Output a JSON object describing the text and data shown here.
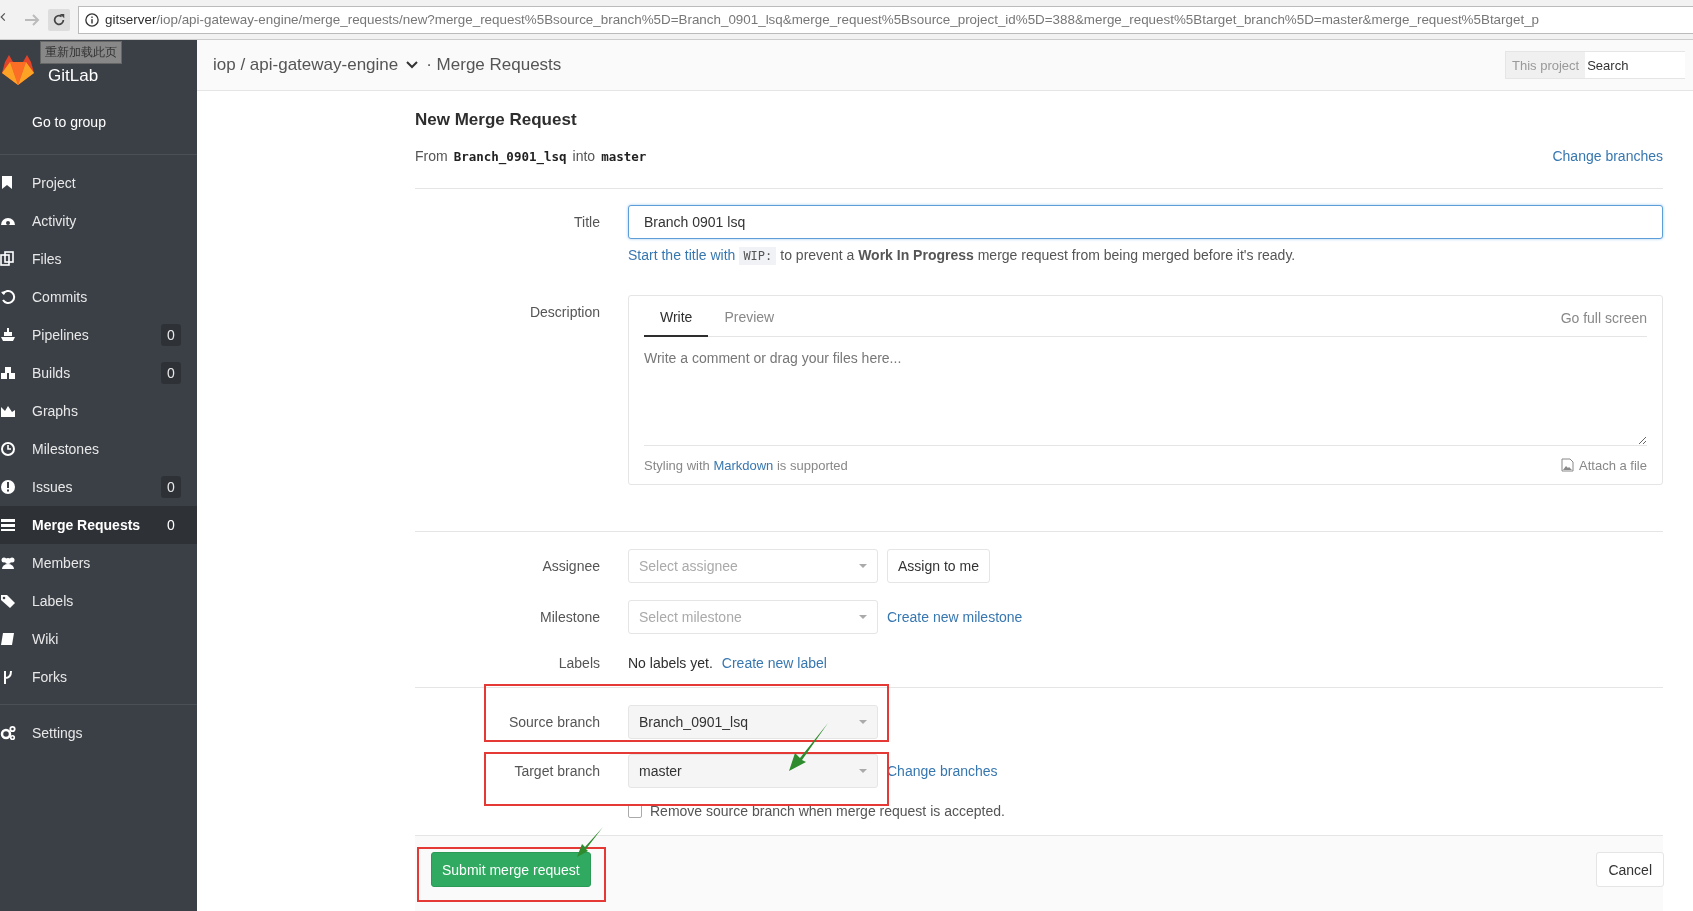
{
  "browser": {
    "url_host": "gitserver",
    "url_path": "/iop/api-gateway-engine/merge_requests/new?merge_request%5Bsource_branch%5D=Branch_0901_lsq&merge_request%5Bsource_project_id%5D=388&merge_request%5Btarget_branch%5D=master&merge_request%5Btarget_p",
    "tooltip": "重新加载此页"
  },
  "sidebar": {
    "logo_text": "GitLab",
    "go_to_group": "Go to group",
    "items": [
      {
        "label": "Project",
        "selected": false
      },
      {
        "label": "Activity",
        "selected": false
      },
      {
        "label": "Files",
        "selected": false
      },
      {
        "label": "Commits",
        "selected": false
      },
      {
        "label": "Pipelines",
        "count": "0",
        "selected": false
      },
      {
        "label": "Builds",
        "count": "0",
        "selected": false
      },
      {
        "label": "Graphs",
        "selected": false
      },
      {
        "label": "Milestones",
        "selected": false
      },
      {
        "label": "Issues",
        "count": "0",
        "selected": false
      },
      {
        "label": "Merge Requests",
        "count": "0",
        "selected": true
      },
      {
        "label": "Members",
        "selected": false
      },
      {
        "label": "Labels",
        "selected": false
      },
      {
        "label": "Wiki",
        "selected": false
      },
      {
        "label": "Forks",
        "selected": false
      }
    ],
    "settings": "Settings"
  },
  "header": {
    "breadcrumb": "iop / api-gateway-engine",
    "section": "· Merge Requests",
    "search_scope": "This project",
    "search_placeholder": "Search"
  },
  "form": {
    "heading": "New Merge Request",
    "from": "From",
    "source": "Branch_0901_lsq",
    "into": "into",
    "target": "master",
    "change_branches": "Change branches",
    "title": {
      "label": "Title",
      "value": "Branch 0901 lsq",
      "hint_link": "Start the title with",
      "hint_code": "WIP:",
      "hint_text": "to prevent a **Work In Progress** merge request from being merged before it's ready."
    },
    "description": {
      "label": "Description",
      "tabs": [
        {
          "label": "Write",
          "selected": true
        },
        {
          "label": "Preview",
          "selected": false
        }
      ],
      "fullscreen": "Go full screen",
      "placeholder": "Write a comment or drag your files here...",
      "styling": "Styling with",
      "markdown": "Markdown",
      "supported": "is supported",
      "attach": "Attach a file"
    },
    "assignee": {
      "label": "Assignee",
      "placeholder": "Select assignee",
      "button": "Assign to me"
    },
    "milestone": {
      "label": "Milestone",
      "placeholder": "Select milestone",
      "link": "Create new milestone"
    },
    "labels": {
      "label": "Labels",
      "empty": "No labels yet.",
      "link": "Create new label"
    },
    "source_branch": {
      "label": "Source branch",
      "value": "Branch_0901_lsq"
    },
    "target_branch": {
      "label": "Target branch",
      "value": "master",
      "link": "Change branches"
    },
    "remove_source": {
      "label": "Remove source branch when merge request is accepted.",
      "checked": false
    },
    "submit": "Submit merge request",
    "cancel": "Cancel"
  }
}
